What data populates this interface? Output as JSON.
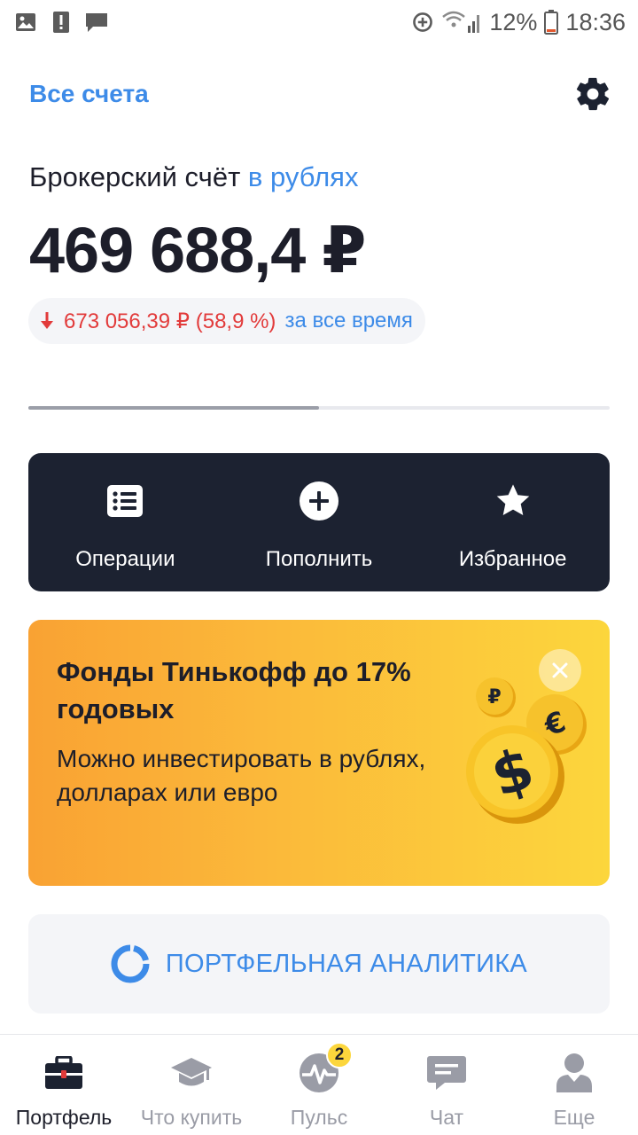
{
  "status_bar": {
    "battery": "12%",
    "time": "18:36"
  },
  "header": {
    "all_accounts": "Все счета"
  },
  "account": {
    "title": "Брокерский счёт",
    "currency_label": "в рублях",
    "balance": "469 688,4 ₽",
    "change_value": "673 056,39 ₽ (58,9 %)",
    "change_period": "за все время",
    "change_direction": "down",
    "progress_fraction": 0.5
  },
  "actions": [
    {
      "label": "Операции",
      "icon": "list-icon"
    },
    {
      "label": "Пополнить",
      "icon": "plus-circle-icon"
    },
    {
      "label": "Избранное",
      "icon": "star-icon"
    }
  ],
  "promo": {
    "title": "Фонды Тинькофф до 17% годовых",
    "text": "Можно инвестировать в рублях, долларах или евро"
  },
  "analytics": {
    "label": "ПОРТФЕЛЬНАЯ АНАЛИТИКА"
  },
  "bottom_nav": {
    "items": [
      {
        "label": "Портфель",
        "icon": "briefcase-icon",
        "active": true
      },
      {
        "label": "Что купить",
        "icon": "graduation-cap-icon",
        "active": false
      },
      {
        "label": "Пульс",
        "icon": "pulse-icon",
        "active": false,
        "badge": "2"
      },
      {
        "label": "Чат",
        "icon": "chat-icon",
        "active": false
      },
      {
        "label": "Еще",
        "icon": "user-icon",
        "active": false
      }
    ]
  },
  "colors": {
    "accent": "#3d8be8",
    "negative": "#e23b3b",
    "dark_card": "#1c2231",
    "promo_gradient_start": "#f9a233",
    "promo_gradient_end": "#fcd63c"
  }
}
